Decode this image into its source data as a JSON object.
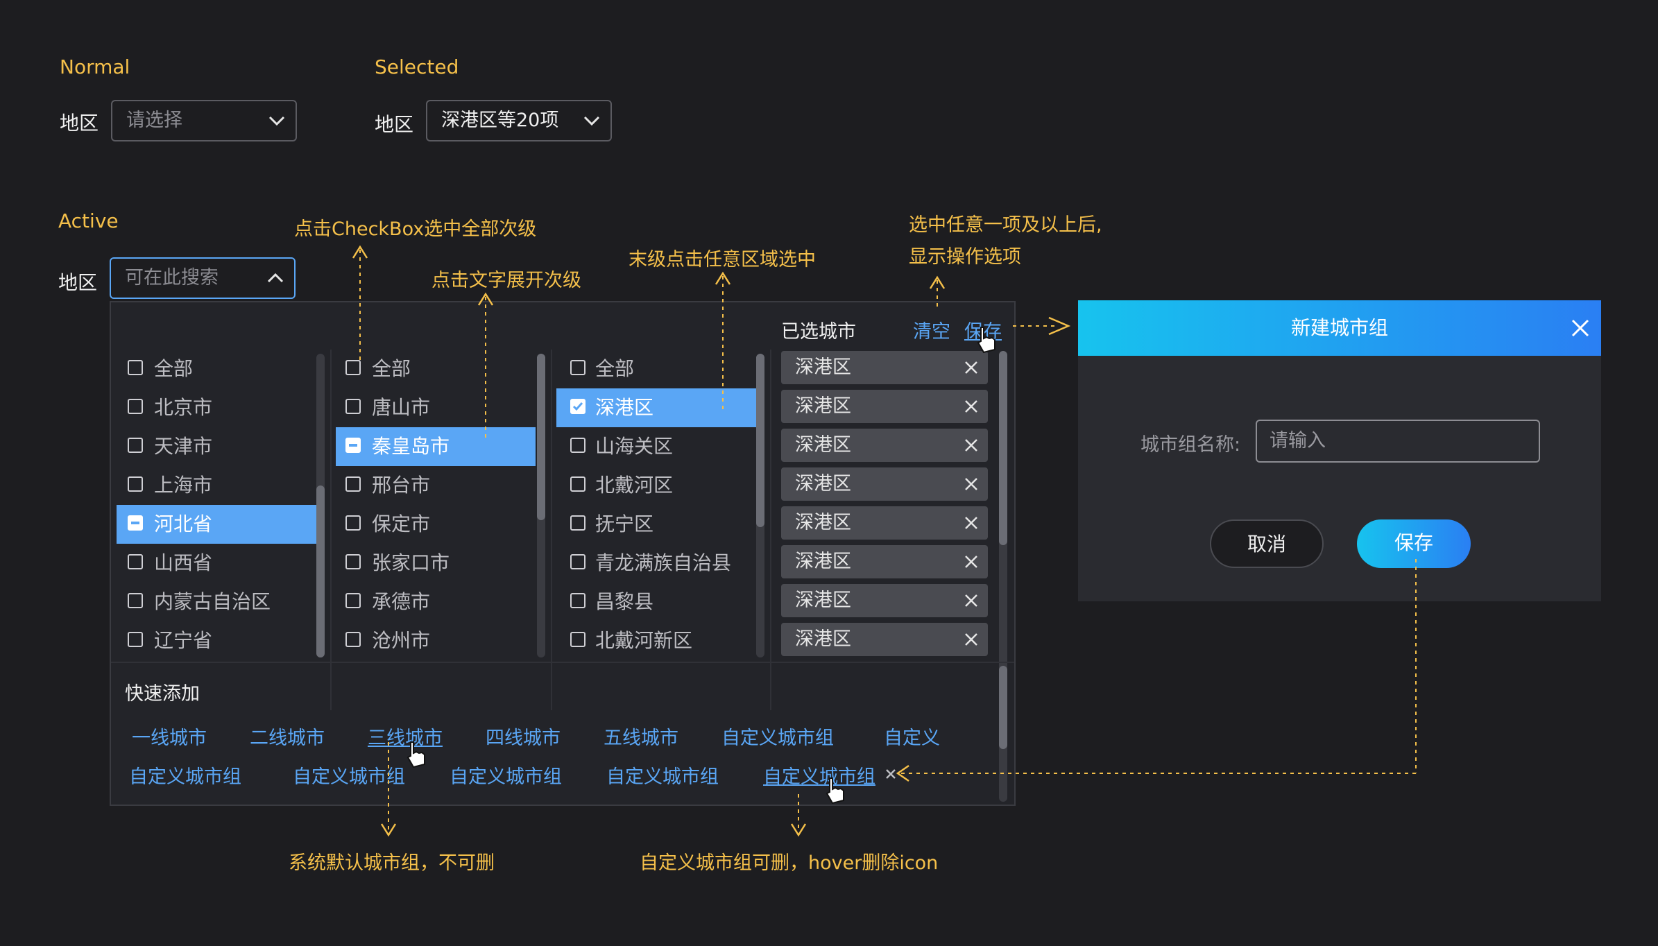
{
  "states": {
    "normal": "Normal",
    "selected": "Selected",
    "active": "Active"
  },
  "field_label": "地区",
  "normal_select": {
    "placeholder": "请选择"
  },
  "selected_select": {
    "value": "深港区等20项"
  },
  "active_select": {
    "placeholder": "可在此搜索"
  },
  "annotations": {
    "a1": "点击CheckBox选中全部次级",
    "a2": "点击文字展开次级",
    "a3": "末级点击任意区域选中",
    "a4_line1": "选中任意一项及以上后,",
    "a4_line2": "显示操作选项",
    "a5": "系统默认城市组，不可删",
    "a6": "自定义城市组可删，hover删除icon"
  },
  "dropdown": {
    "col1": [
      "全部",
      "北京市",
      "天津市",
      "上海市",
      "河北省",
      "山西省",
      "内蒙古自治区",
      "辽宁省"
    ],
    "col1_selected": "河北省",
    "col2": [
      "全部",
      "唐山市",
      "秦皇岛市",
      "邢台市",
      "保定市",
      "张家口市",
      "承德市",
      "沧州市"
    ],
    "col2_selected": "秦皇岛市",
    "col3": [
      "全部",
      "深港区",
      "山海关区",
      "北戴河区",
      "抚宁区",
      "青龙满族自治县",
      "昌黎县",
      "北戴河新区"
    ],
    "col3_selected": "深港区",
    "selected_title": "已选城市",
    "clear": "清空",
    "save": "保存",
    "selected_tags": [
      "深港区",
      "深港区",
      "深港区",
      "深港区",
      "深港区",
      "深港区",
      "深港区",
      "深港区"
    ],
    "quick_add_title": "快速添加",
    "quick_row1": [
      "一线城市",
      "二线城市",
      "三线城市",
      "四线城市",
      "五线城市",
      "自定义城市组",
      "自定义"
    ],
    "quick_row2": [
      "自定义城市组",
      "自定义城市组",
      "自定义城市组",
      "自定义城市组",
      "自定义城市组"
    ]
  },
  "dialog": {
    "title": "新建城市组",
    "field_label": "城市组名称:",
    "placeholder": "请输入",
    "cancel": "取消",
    "save": "保存"
  },
  "colors": {
    "accent": "#5aa6f5",
    "annotation": "#f5c04a",
    "bg": "#1d1d20",
    "panel": "#232429"
  }
}
